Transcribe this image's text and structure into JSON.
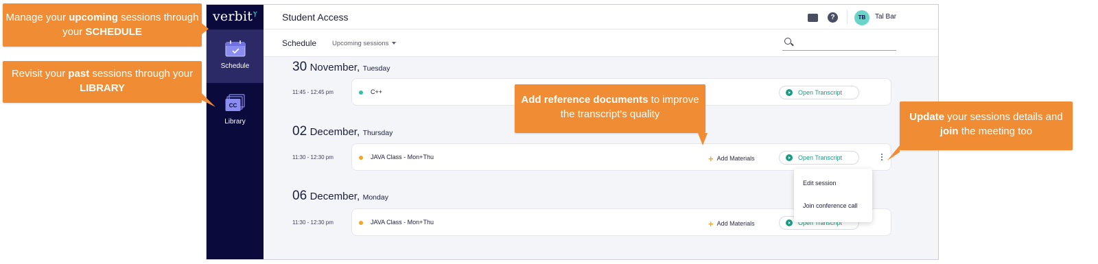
{
  "app": {
    "logo": "verbit",
    "title": "Student Access",
    "user": {
      "initials": "TB",
      "name": "Tal Bar"
    }
  },
  "sidebar": {
    "items": [
      {
        "label": "Schedule",
        "icon": "calendar-icon",
        "active": true
      },
      {
        "label": "Library",
        "icon": "library-cc-icon",
        "active": false
      }
    ]
  },
  "toolbar": {
    "tab": "Schedule",
    "filter": "Upcoming sessions",
    "search_placeholder": ""
  },
  "days": [
    {
      "day_num": "30",
      "month": "November,",
      "weekday": "Tuesday",
      "sessions": [
        {
          "time": "11:45 - 12:45 pm",
          "title": "C++",
          "dot_color": "#2ec4a0",
          "add_materials": null,
          "open_transcript": "Open Transcript"
        }
      ]
    },
    {
      "day_num": "02",
      "month": "December,",
      "weekday": "Thursday",
      "sessions": [
        {
          "time": "11:30 - 12:30 pm",
          "title": "JAVA Class - Mon+Thu",
          "dot_color": "#f5a623",
          "add_materials": "Add Materials",
          "open_transcript": "Open Transcript"
        }
      ]
    },
    {
      "day_num": "06",
      "month": "December,",
      "weekday": "Monday",
      "sessions": [
        {
          "time": "11:30 - 12:30 pm",
          "title": "JAVA Class - Mon+Thu",
          "dot_color": "#f5a623",
          "add_materials": "Add Materials",
          "open_transcript": "Open Transcript"
        }
      ]
    }
  ],
  "context_menu": {
    "items": [
      "Edit session",
      "Join conference call"
    ]
  },
  "callouts": {
    "schedule": {
      "pre": "Manage your ",
      "b1": "upcoming",
      "mid": " sessions through your ",
      "b2": "SCHEDULE"
    },
    "library": {
      "pre": "Revisit your  ",
      "b1": "past",
      "mid": " sessions through your ",
      "b2": "LIBRARY"
    },
    "reference": {
      "b1": "Add reference documents",
      "post": " to improve the transcript's quality"
    },
    "update": {
      "b1": "Update",
      "mid": " your sessions details and ",
      "b2": "join",
      "post": " the meeting too"
    }
  },
  "colors": {
    "sidebar_bg": "#0b0a3d",
    "callout_orange": "#f08c34",
    "accent_green": "#1d9a82",
    "accent_yellow": "#f5a623"
  }
}
